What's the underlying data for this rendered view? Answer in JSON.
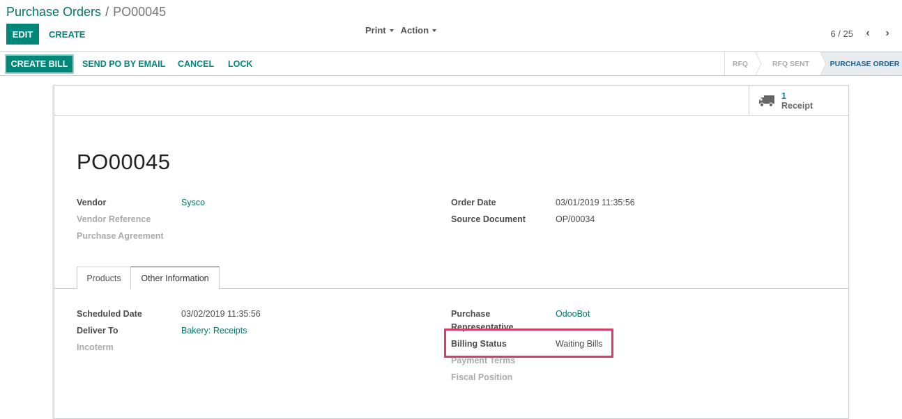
{
  "breadcrumb": {
    "parent": "Purchase Orders",
    "separator": "/",
    "current": "PO00045"
  },
  "control_panel": {
    "edit_label": "EDIT",
    "create_label": "CREATE",
    "print_label": "Print",
    "action_label": "Action",
    "pager": {
      "value": "6 / 25",
      "prev_icon": "chevron-left-icon",
      "next_icon": "chevron-right-icon"
    }
  },
  "statusbar": {
    "buttons": {
      "create_bill": "CREATE BILL",
      "send_po": "SEND PO BY EMAIL",
      "cancel": "CANCEL",
      "lock": "LOCK"
    },
    "stages": [
      {
        "label": "RFQ",
        "active": false
      },
      {
        "label": "RFQ SENT",
        "active": false
      },
      {
        "label": "PURCHASE ORDER",
        "active": true
      }
    ]
  },
  "smart_button": {
    "icon": "truck-icon",
    "count": "1",
    "label": "Receipt"
  },
  "record": {
    "name": "PO00045",
    "left_fields": [
      {
        "label": "Vendor",
        "value": "Sysco",
        "muted": false,
        "link": true
      },
      {
        "label": "Vendor Reference",
        "value": "",
        "muted": true
      },
      {
        "label": "Purchase Agreement",
        "value": "",
        "muted": true
      }
    ],
    "right_fields": [
      {
        "label": "Order Date",
        "value": "03/01/2019 11:35:56"
      },
      {
        "label": "Source Document",
        "value": "OP/00034"
      }
    ]
  },
  "tabs": [
    {
      "label": "Products",
      "active": false
    },
    {
      "label": "Other Information",
      "active": true
    }
  ],
  "other_info": {
    "left": [
      {
        "label": "Scheduled Date",
        "value": "03/02/2019 11:35:56"
      },
      {
        "label": "Deliver To",
        "value": "Bakery: Receipts"
      },
      {
        "label": "Incoterm",
        "value": ""
      }
    ],
    "right": [
      {
        "label": "Purchase Representative",
        "value": "OdooBot"
      },
      {
        "label": "Billing Status",
        "value": "Waiting Bills"
      },
      {
        "label": "Payment Terms",
        "value": ""
      },
      {
        "label": "Fiscal Position",
        "value": ""
      }
    ]
  },
  "colors": {
    "accent": "#00877a",
    "link": "#00756a",
    "active_stage": "#1d5d8c",
    "highlight": "#d63d69"
  }
}
